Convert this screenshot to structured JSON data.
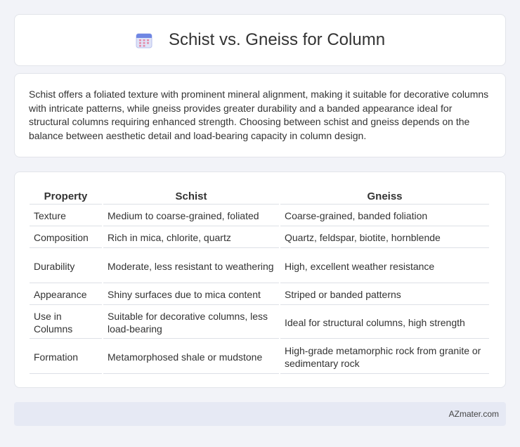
{
  "header": {
    "title": "Schist vs. Gneiss for Column",
    "icon": "calendar-icon"
  },
  "description": "Schist offers a foliated texture with prominent mineral alignment, making it suitable for decorative columns with intricate patterns, while gneiss provides greater durability and a banded appearance ideal for structural columns requiring enhanced strength. Choosing between schist and gneiss depends on the balance between aesthetic detail and load-bearing capacity in column design.",
  "table": {
    "headers": [
      "Property",
      "Schist",
      "Gneiss"
    ],
    "rows": [
      [
        "Texture",
        "Medium to coarse-grained, foliated",
        "Coarse-grained, banded foliation"
      ],
      [
        "Composition",
        "Rich in mica, chlorite, quartz",
        "Quartz, feldspar, biotite, hornblende"
      ],
      [
        "Durability",
        "Moderate, less resistant to weathering",
        "High, excellent weather resistance"
      ],
      [
        "Appearance",
        "Shiny surfaces due to mica content",
        "Striped or banded patterns"
      ],
      [
        "Use in Columns",
        "Suitable for decorative columns, less load-bearing",
        "Ideal for structural columns, high strength"
      ],
      [
        "Formation",
        "Metamorphosed shale or mudstone",
        "High-grade metamorphic rock from granite or sedimentary rock"
      ]
    ]
  },
  "footer": {
    "text": "AZmater.com"
  }
}
